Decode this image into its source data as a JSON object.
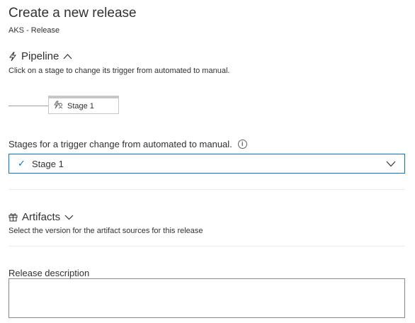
{
  "header": {
    "title": "Create a new release",
    "subtitle": "AKS - Release"
  },
  "pipeline": {
    "heading": "Pipeline",
    "hint": "Click on a stage to change its trigger from automated to manual.",
    "stage_name": "Stage 1"
  },
  "trigger": {
    "label": "Stages for a trigger change from automated to manual.",
    "selected": "Stage 1"
  },
  "artifacts": {
    "heading": "Artifacts",
    "hint": "Select the version for the artifact sources for this release"
  },
  "release": {
    "description_label": "Release description",
    "description_value": ""
  },
  "colors": {
    "accent": "#0078d4",
    "text": "#323130",
    "border": "#c8c6c4"
  }
}
